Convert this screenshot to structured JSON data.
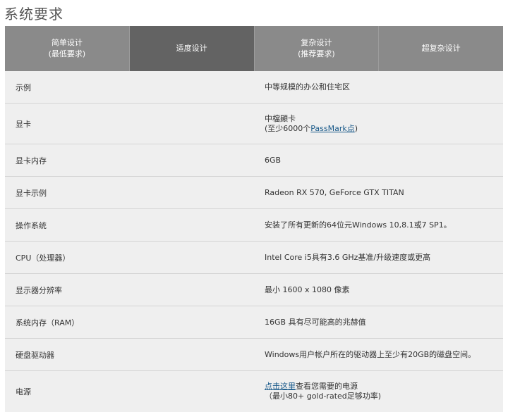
{
  "page": {
    "title": "系统要求"
  },
  "tabs": [
    {
      "line1": "简单设计",
      "line2": "(最低要求)"
    },
    {
      "line1": "适度设计",
      "line2": ""
    },
    {
      "line1": "复杂设计",
      "line2": "(推荐要求)"
    },
    {
      "line1": "超复杂设计",
      "line2": ""
    }
  ],
  "active_tab": 1,
  "rows": [
    {
      "label": "示例",
      "value": "中等规模的办公和住宅区"
    },
    {
      "label": "显卡",
      "value_line1": "中檔顯卡",
      "value_line2_prefix": "(至少6000个",
      "value_line2_link": "PassMark点",
      "value_line2_suffix": ")"
    },
    {
      "label": "显卡内存",
      "value": "6GB"
    },
    {
      "label": "显卡示例",
      "value": "Radeon RX 570, GeForce GTX TITAN"
    },
    {
      "label": "操作系统",
      "value": "安装了所有更新的64位元Windows 10,8.1或7 SP1。"
    },
    {
      "label": "CPU（处理器）",
      "value": "Intel Core i5具有3.6 GHz基准/升级速度或更高"
    },
    {
      "label": "显示器分辨率",
      "value": "最小 1600 x 1080 像素"
    },
    {
      "label": "系统内存（RAM）",
      "value": "16GB 具有尽可能高的兆赫值"
    },
    {
      "label": "硬盘驱动器",
      "value": "Windows用户帐户所在的驱动器上至少有20GB的磁盘空间。"
    },
    {
      "label": "电源",
      "value_link": "点击这里",
      "value_line1_suffix": "查看您需要的电源",
      "value_line2": "（最小80+ gold-rated足够功率)"
    }
  ]
}
